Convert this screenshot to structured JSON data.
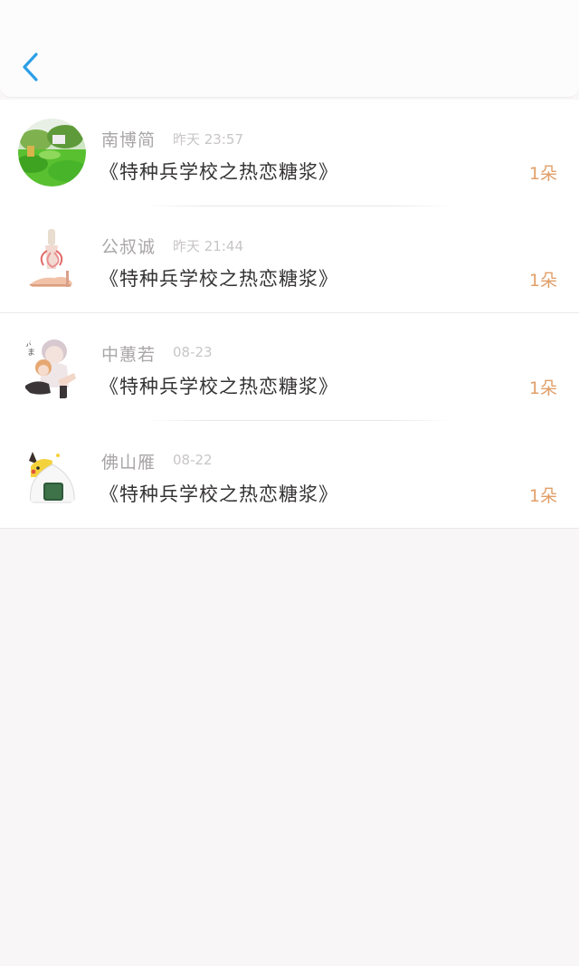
{
  "header": {
    "back_icon": "chevron-left-icon",
    "accent_color": "#2b9fe6"
  },
  "messages": [
    {
      "name": "南博简",
      "time": "昨天 23:57",
      "title": "《特种兵学校之热恋糖浆》",
      "count": "1朵",
      "avatar": "landscape-avatar"
    },
    {
      "name": "公叔诚",
      "time": "昨天 21:44",
      "title": "《特种兵学校之热恋糖浆》",
      "count": "1朵",
      "avatar": "high-heel-avatar"
    },
    {
      "name": "中蕙若",
      "time": "08-23",
      "title": "《特种兵学校之热恋糖浆》",
      "count": "1朵",
      "avatar": "anime-couple-avatar"
    },
    {
      "name": "佛山雁",
      "time": "08-22",
      "title": "《特种兵学校之热恋糖浆》",
      "count": "1朵",
      "avatar": "onigiri-pikachu-avatar"
    }
  ],
  "colors": {
    "name": "#a9a6a7",
    "time": "#c8c5c6",
    "title": "#353334",
    "count": "#e19f69",
    "background": "#f8f6f7"
  }
}
